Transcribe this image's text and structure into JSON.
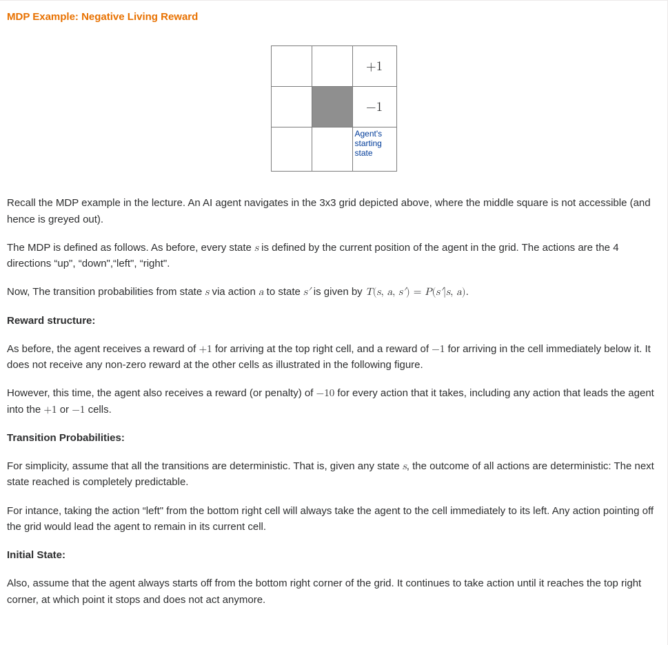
{
  "title": "MDP Example: Negative Living Reward",
  "grid": {
    "plus1": "+1",
    "minus1": "−1",
    "start": "Agent's starting state"
  },
  "p1a": "Recall the MDP example in the lecture. An AI agent navigates in the 3x3 grid depicted above, where the middle square is not accessible (and hence is greyed out).",
  "p2a": "The MDP is defined as follows. As before, every state ",
  "p2b": " is defined by the current position of the agent in the grid. The actions are the 4 directions “up\", “down\",“left\", “right\".",
  "p3a": "Now, The transition probabilities from state ",
  "p3b": " via action ",
  "p3c": " to state ",
  "p3d": "  is given by ",
  "p3e": ".",
  "head_reward": "Reward structure:",
  "p4a": "As before, the agent receives a reward of ",
  "p4b": " for arriving at the top right cell, and a reward of ",
  "p4c": " for arriving in the cell immediately below it. It does not receive any non-zero reward at the other cells as illustrated in the following figure.",
  "p5a": "However, this time, the agent also receives a reward (or penalty) of ",
  "p5b": " for every action that it takes, including any action that leads the agent into the ",
  "p5c": " or ",
  "p5d": " cells.",
  "head_trans": "Transition Probabilities:",
  "p6a": "For simplicity, assume that all the transitions are deterministic. That is, given any state ",
  "p6b": ", the outcome of all actions are deterministic: The next state reached is completely predictable.",
  "p7a": "For intance, taking the action “left\" from the bottom right cell will always take the agent to the cell immediately to its left. Any action pointing off the grid would lead the agent to remain in its current cell.",
  "head_init": "Initial State:",
  "p8a": "Also, assume that the agent always starts off from the bottom right corner of the grid. It continues to take action until it reaches the top right corner, at which point it stops and does not act anymore.",
  "math": {
    "s": "s",
    "a": "a",
    "sprime": "s′",
    "T": "T",
    "eq": " = ",
    "P": "P",
    "lp": "(",
    "rp": ")",
    "comma": ", ",
    "bar": "|",
    "plus1": "+1",
    "minus1": "−1",
    "minus10": "−10"
  }
}
